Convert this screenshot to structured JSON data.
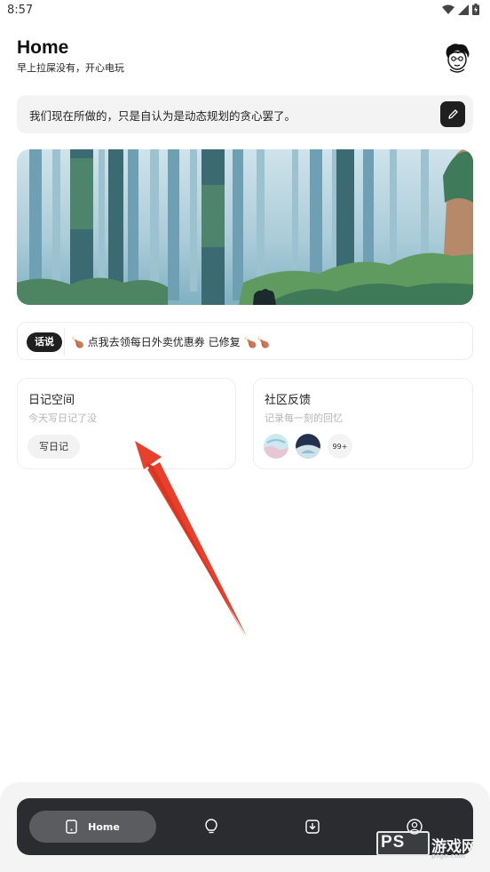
{
  "status_bar": {
    "time": "8:57"
  },
  "header": {
    "title": "Home",
    "subtitle": "早上拉屎没有，开心电玩"
  },
  "quote": {
    "text": "我们现在所做的，只是自认为是动态规划的贪心罢了。"
  },
  "notice": {
    "tag": "话说",
    "text": "点我去领每日外卖优惠券 已修复"
  },
  "cards": {
    "diary": {
      "title": "日记空间",
      "subtitle": "今天写日记了没",
      "button": "写日记"
    },
    "community": {
      "title": "社区反馈",
      "subtitle": "记录每一刻的回忆",
      "count": "99+"
    }
  },
  "nav": {
    "items": [
      {
        "label": "Home",
        "icon": "phone-icon",
        "active": true
      },
      {
        "icon": "lightbulb-icon"
      },
      {
        "icon": "download-icon"
      },
      {
        "icon": "user-icon"
      }
    ]
  },
  "watermark": {
    "brand": "PS",
    "text": "游戏网",
    "url": "psgo.com"
  },
  "colors": {
    "accent_dark": "#1f1f1f",
    "nav_bg": "#2b2c2f",
    "nav_active": "#5b5c60",
    "arrow": "#e8402c"
  }
}
